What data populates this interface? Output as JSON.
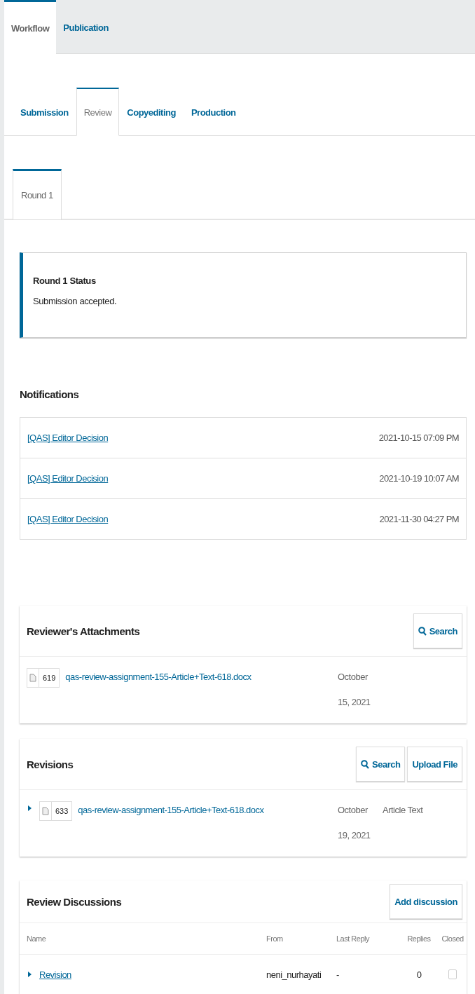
{
  "top_tabs": [
    {
      "label": "Workflow",
      "selected": true
    },
    {
      "label": "Publication",
      "selected": false
    }
  ],
  "stage_tabs": [
    {
      "label": "Submission",
      "selected": false
    },
    {
      "label": "Review",
      "selected": true
    },
    {
      "label": "Copyediting",
      "selected": false
    },
    {
      "label": "Production",
      "selected": false
    }
  ],
  "round_tabs": [
    {
      "label": "Round 1",
      "selected": true
    }
  ],
  "status": {
    "title": "Round 1 Status",
    "message": "Submission accepted."
  },
  "notifications": {
    "title": "Notifications",
    "items": [
      {
        "subject": "[QAS] Editor Decision",
        "date": "2021-10-15 07:09 PM"
      },
      {
        "subject": "[QAS] Editor Decision",
        "date": "2021-10-19 10:07 AM"
      },
      {
        "subject": "[QAS] Editor Decision",
        "date": "2021-11-30 04:27 PM"
      }
    ]
  },
  "attachments": {
    "title": "Reviewer's Attachments",
    "buttons": [
      {
        "label": "Search",
        "kind": "search"
      }
    ],
    "files": [
      {
        "id": "619",
        "name": "qas-review-assignment-155-Article+Text-618.docx",
        "date": "October 15, 2021"
      }
    ]
  },
  "revisions": {
    "title": "Revisions",
    "buttons": [
      {
        "label": "Search",
        "kind": "search"
      },
      {
        "label": "Upload File",
        "kind": "plain"
      }
    ],
    "files": [
      {
        "expanded": false,
        "id": "633",
        "name": "qas-review-assignment-155-Article+Text-618.docx",
        "date": "October 19, 2021",
        "type": "Article Text"
      }
    ]
  },
  "discussions": {
    "title": "Review Discussions",
    "buttons": [
      {
        "label": "Add discussion",
        "kind": "plain"
      }
    ],
    "columns": [
      "Name",
      "From",
      "Last Reply",
      "Replies",
      "Closed"
    ],
    "rows": [
      {
        "expanded": false,
        "name": "Revision",
        "from": "neni_nurhayati",
        "last_reply": "-",
        "replies": "0",
        "closed": false
      }
    ]
  }
}
